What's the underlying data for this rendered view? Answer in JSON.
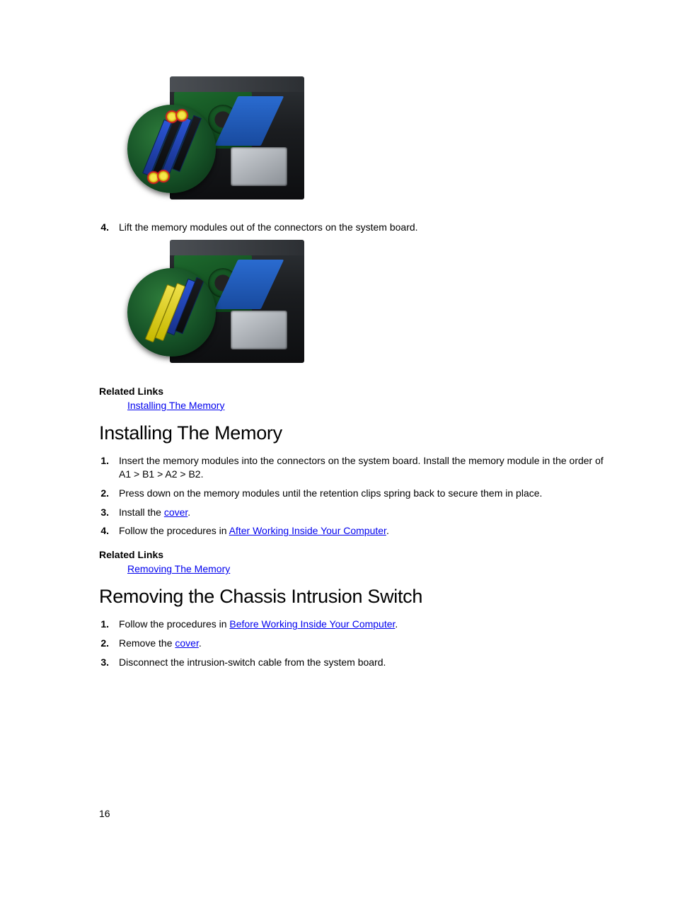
{
  "step4": {
    "num": "4.",
    "text": "Lift the memory modules out of the connectors on the system board."
  },
  "relatedLinksLabel": "Related Links",
  "relatedLinkInstall": "Installing The Memory",
  "relatedLinkRemove": "Removing The Memory",
  "sectionInstall": {
    "heading": "Installing The Memory",
    "items": [
      {
        "num": "1.",
        "prefix": "Insert the memory modules into the connectors on the system board. Install the memory module in the order of A1 > B1 > A2 > B2."
      },
      {
        "num": "2.",
        "prefix": "Press down on the memory modules until the retention clips spring back to secure them in place."
      },
      {
        "num": "3.",
        "prefix": "Install the ",
        "link": "cover",
        "suffix": "."
      },
      {
        "num": "4.",
        "prefix": "Follow the procedures in ",
        "link": "After Working Inside Your Computer",
        "suffix": "."
      }
    ]
  },
  "sectionRemoveSwitch": {
    "heading": "Removing the Chassis Intrusion Switch",
    "items": [
      {
        "num": "1.",
        "prefix": "Follow the procedures in ",
        "link": "Before Working Inside Your Computer",
        "suffix": "."
      },
      {
        "num": "2.",
        "prefix": "Remove the ",
        "link": "cover",
        "suffix": "."
      },
      {
        "num": "3.",
        "prefix": "Disconnect the intrusion-switch cable from the system board."
      }
    ]
  },
  "pageNumber": "16"
}
